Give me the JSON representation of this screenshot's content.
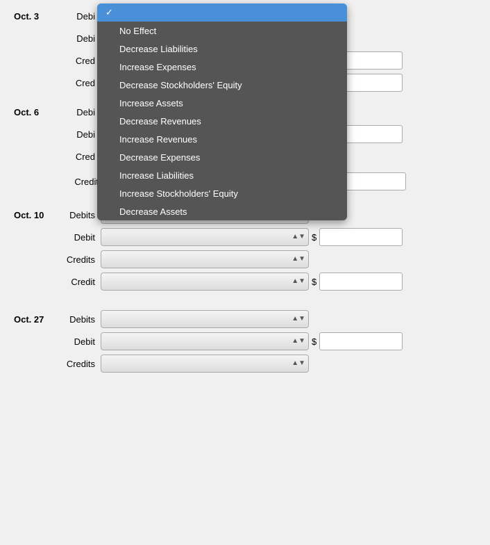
{
  "dates": [
    {
      "id": "oct3",
      "label": "Oct. 3",
      "rows": [
        {
          "id": "row1",
          "label": "Debi",
          "hasSelect": true,
          "hasDollar": false,
          "selectWidth": "wide"
        },
        {
          "id": "row2",
          "label": "Debi",
          "hasSelect": false,
          "hasDollar": false,
          "selectWidth": ""
        },
        {
          "id": "row3",
          "label": "Cred",
          "hasSelect": false,
          "hasDollar": true,
          "selectWidth": ""
        },
        {
          "id": "row4",
          "label": "Cred",
          "hasSelect": false,
          "hasDollar": true,
          "selectWidth": ""
        }
      ]
    },
    {
      "id": "oct6",
      "label": "Oct. 6",
      "rows": [
        {
          "id": "row5",
          "label": "Debi",
          "hasSelect": true,
          "hasDollar": false,
          "selectWidth": "wide"
        },
        {
          "id": "row6",
          "label": "Debi",
          "hasSelect": true,
          "hasDollar": true,
          "selectWidth": "wide"
        },
        {
          "id": "row7",
          "label": "Cred",
          "hasSelect": false,
          "hasDollar": false,
          "selectWidth": ""
        },
        {
          "id": "row8",
          "label": "Cred",
          "hasSelect": true,
          "hasDollar": false,
          "selectWidth": "wide"
        }
      ]
    },
    {
      "id": "oct6b",
      "label": "",
      "rows": [
        {
          "id": "row9",
          "label": "Credit",
          "hasSelect": true,
          "hasDollar": true,
          "selectWidth": "wide"
        }
      ]
    },
    {
      "id": "oct10",
      "label": "Oct. 10",
      "rows": [
        {
          "id": "row10",
          "label": "Debits",
          "hasSelect": true,
          "hasDollar": false,
          "selectWidth": "wide"
        },
        {
          "id": "row11",
          "label": "Debit",
          "hasSelect": true,
          "hasDollar": true,
          "selectWidth": "wide"
        },
        {
          "id": "row12",
          "label": "Credits",
          "hasSelect": true,
          "hasDollar": false,
          "selectWidth": "wide"
        },
        {
          "id": "row13",
          "label": "Credit",
          "hasSelect": true,
          "hasDollar": true,
          "selectWidth": "wide"
        }
      ]
    },
    {
      "id": "oct27",
      "label": "Oct. 27",
      "rows": [
        {
          "id": "row14",
          "label": "Debits",
          "hasSelect": true,
          "hasDollar": false,
          "selectWidth": "wide"
        },
        {
          "id": "row15",
          "label": "Debit",
          "hasSelect": true,
          "hasDollar": true,
          "selectWidth": "wide"
        },
        {
          "id": "row16",
          "label": "Credits",
          "hasSelect": true,
          "hasDollar": false,
          "selectWidth": "wide"
        }
      ]
    }
  ],
  "dropdown": {
    "items": [
      {
        "id": "selected",
        "label": "",
        "checked": true
      },
      {
        "id": "no-effect",
        "label": "No Effect",
        "checked": false
      },
      {
        "id": "decrease-liabilities",
        "label": "Decrease Liabilities",
        "checked": false
      },
      {
        "id": "increase-expenses",
        "label": "Increase Expenses",
        "checked": false
      },
      {
        "id": "decrease-stockholders-equity",
        "label": "Decrease Stockholders' Equity",
        "checked": false
      },
      {
        "id": "increase-assets",
        "label": "Increase Assets",
        "checked": false
      },
      {
        "id": "decrease-revenues",
        "label": "Decrease Revenues",
        "checked": false
      },
      {
        "id": "increase-revenues",
        "label": "Increase Revenues",
        "checked": false
      },
      {
        "id": "decrease-expenses",
        "label": "Decrease Expenses",
        "checked": false
      },
      {
        "id": "increase-liabilities",
        "label": "Increase Liabilities",
        "checked": false
      },
      {
        "id": "increase-stockholders-equity",
        "label": "Increase Stockholders' Equity",
        "checked": false
      },
      {
        "id": "decrease-assets",
        "label": "Decrease Assets",
        "checked": false
      }
    ]
  },
  "labels": {
    "oct3": "Oct. 3",
    "oct6": "Oct. 6",
    "oct10": "Oct. 10",
    "oct27": "Oct. 27",
    "debi": "Debi",
    "debit": "Debit",
    "debits": "Debits",
    "cred": "Cred",
    "credit": "Credit",
    "credits": "Credits",
    "dollar": "$"
  }
}
